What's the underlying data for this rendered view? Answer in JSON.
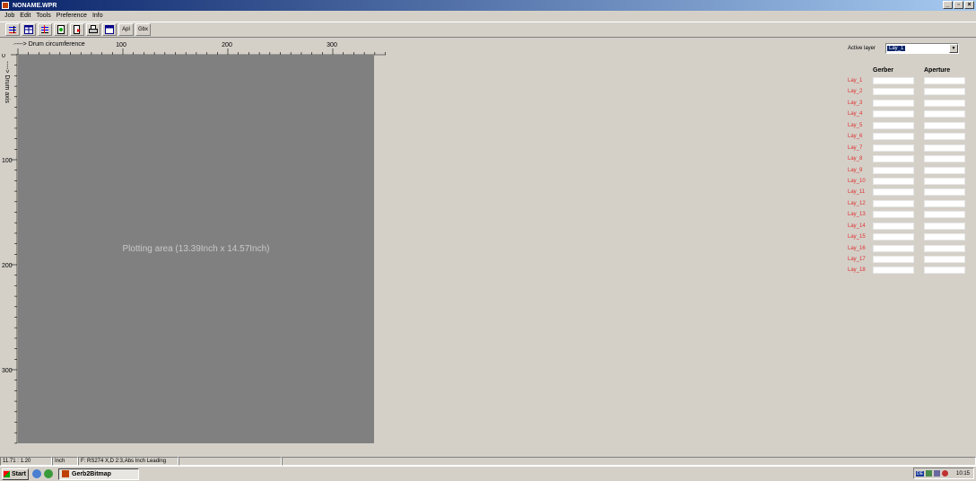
{
  "window": {
    "title": "NONAME.WPR"
  },
  "menu": [
    "Job",
    "Edit",
    "Tools",
    "Preference",
    "Info"
  ],
  "toolbar": {
    "apl_label": "Apl",
    "gbx_label": "Gbx"
  },
  "rulers": {
    "drum_circumference_label": "·----> Drum circumference",
    "drum_axis_label": "----> Drum axis",
    "top_ticks": [
      "100",
      "200",
      "300"
    ],
    "left_ticks": [
      "0",
      "100",
      "200",
      "300"
    ]
  },
  "plot": {
    "label": "Plotting area (13.39Inch x 14.57Inch)"
  },
  "layers": {
    "active_layer_label": "Active layer",
    "active_layer_value": "Lay_1",
    "gerber_header": "Gerber",
    "aperture_header": "Aperture",
    "names": [
      "Lay_1",
      "Lay_2",
      "Lay_3",
      "Lay_4",
      "Lay_5",
      "Lay_6",
      "Lay_7",
      "Lay_8",
      "Lay_9",
      "Lay_10",
      "Lay_11",
      "Lay_12",
      "Lay_13",
      "Lay_14",
      "Lay_15",
      "Lay_16",
      "Lay_17",
      "Lay_18"
    ],
    "name_color": "#e03030"
  },
  "status": {
    "coords": "11.71 : 1.20",
    "units": "Inch",
    "format": "F: RS274 X,D 2:3,Abs Inch Leading"
  },
  "taskbar": {
    "start_label": "Start",
    "task_label": "Gerb2Bitmap",
    "tray_lang": "DE",
    "clock": "10:15"
  }
}
